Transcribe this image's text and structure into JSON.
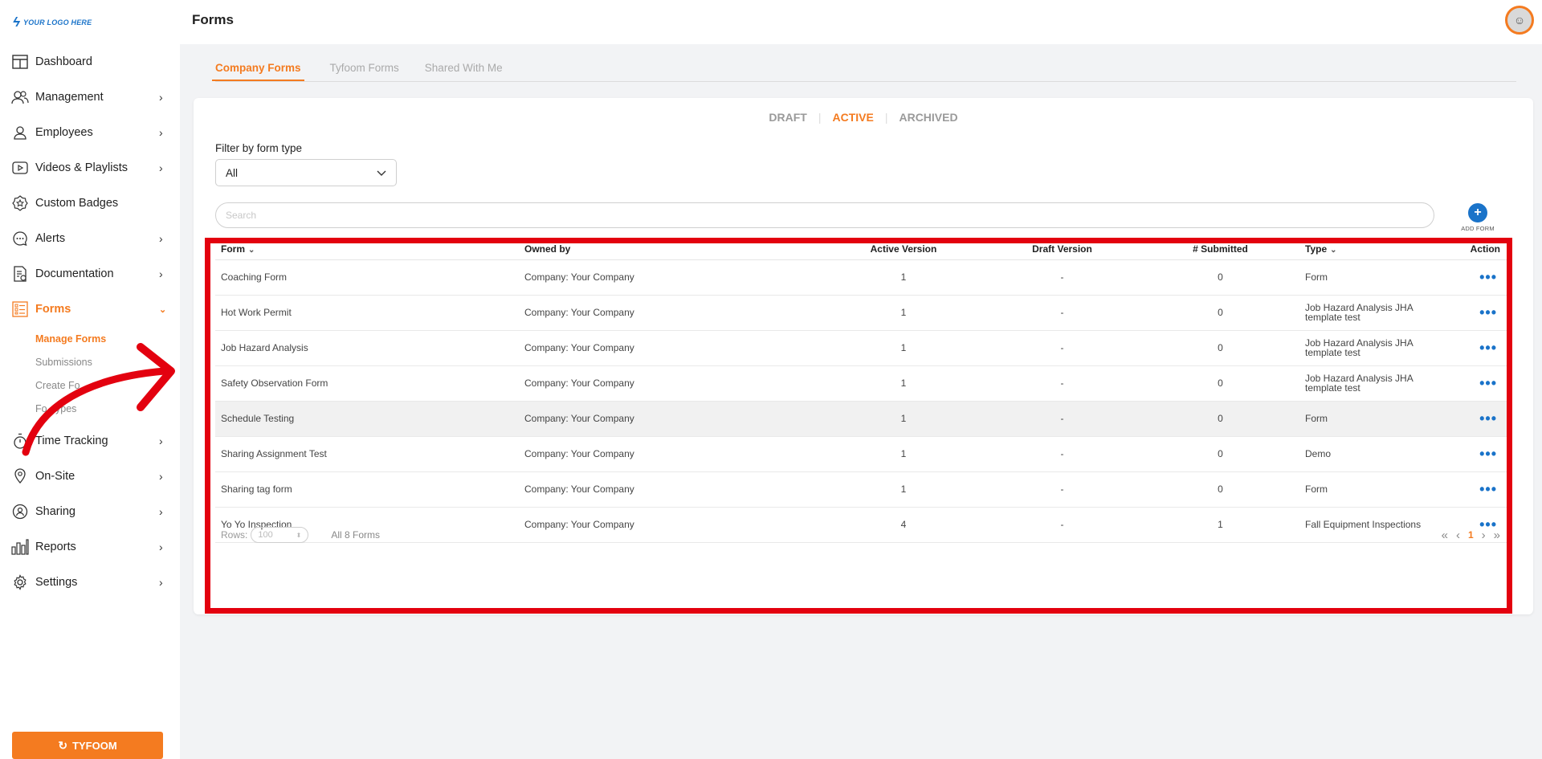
{
  "logo": {
    "text": "YOUR LOGO HERE"
  },
  "sidebar": {
    "items": [
      {
        "label": "Dashboard",
        "icon": "dashboard-icon",
        "chevron": false
      },
      {
        "label": "Management",
        "icon": "users-icon",
        "chevron": true
      },
      {
        "label": "Employees",
        "icon": "user-icon",
        "chevron": true
      },
      {
        "label": "Videos & Playlists",
        "icon": "play-icon",
        "chevron": true
      },
      {
        "label": "Custom Badges",
        "icon": "badge-icon",
        "chevron": false
      },
      {
        "label": "Alerts",
        "icon": "chat-icon",
        "chevron": true
      },
      {
        "label": "Documentation",
        "icon": "document-icon",
        "chevron": true
      },
      {
        "label": "Forms",
        "icon": "form-list-icon",
        "chevron": true,
        "active": true
      }
    ],
    "forms_sub": [
      "Manage Forms",
      "Submissions",
      "Create Fo",
      "Fo   ypes"
    ],
    "items_after": [
      {
        "label": "Time Tracking",
        "icon": "stopwatch-icon"
      },
      {
        "label": "On-Site",
        "icon": "location-pin-icon"
      },
      {
        "label": "Sharing",
        "icon": "share-user-icon"
      },
      {
        "label": "Reports",
        "icon": "bar-chart-icon"
      },
      {
        "label": "Settings",
        "icon": "gear-icon"
      }
    ],
    "brand_button": "TYFOOM"
  },
  "header": {
    "title": "Forms"
  },
  "tabs": [
    "Company Forms",
    "Tyfoom Forms",
    "Shared With Me"
  ],
  "status_tabs": [
    "DRAFT",
    "ACTIVE",
    "ARCHIVED"
  ],
  "filter": {
    "label": "Filter by form type",
    "value": "All"
  },
  "search": {
    "placeholder": "Search"
  },
  "add_form": {
    "label": "ADD FORM"
  },
  "table": {
    "columns": [
      "Form",
      "Owned by",
      "Active Version",
      "Draft Version",
      "# Submitted",
      "Type",
      "Action"
    ],
    "rows": [
      {
        "form": "Coaching Form",
        "owner": "Company: Your Company",
        "active": "1",
        "draft": "-",
        "submitted": "0",
        "type": "Form"
      },
      {
        "form": "Hot Work Permit",
        "owner": "Company: Your Company",
        "active": "1",
        "draft": "-",
        "submitted": "0",
        "type": "Job Hazard Analysis JHA template test"
      },
      {
        "form": "Job Hazard Analysis",
        "owner": "Company: Your Company",
        "active": "1",
        "draft": "-",
        "submitted": "0",
        "type": "Job Hazard Analysis JHA template test"
      },
      {
        "form": "Safety Observation Form",
        "owner": "Company: Your Company",
        "active": "1",
        "draft": "-",
        "submitted": "0",
        "type": "Job Hazard Analysis JHA template test"
      },
      {
        "form": "Schedule Testing",
        "owner": "Company: Your Company",
        "active": "1",
        "draft": "-",
        "submitted": "0",
        "type": "Form"
      },
      {
        "form": "Sharing Assignment Test",
        "owner": "Company: Your Company",
        "active": "1",
        "draft": "-",
        "submitted": "0",
        "type": "Demo"
      },
      {
        "form": "Sharing tag form",
        "owner": "Company: Your Company",
        "active": "1",
        "draft": "-",
        "submitted": "0",
        "type": "Form"
      },
      {
        "form": "Yo Yo Inspection",
        "owner": "Company: Your Company",
        "active": "4",
        "draft": "-",
        "submitted": "1",
        "type": "Fall Equipment Inspections"
      }
    ]
  },
  "footer": {
    "rows_label": "Rows:",
    "rows_value": "100",
    "count": "All 8 Forms",
    "page": "1"
  },
  "colors": {
    "accent": "#f47b20",
    "link": "#1a73c9",
    "annotation": "#e3010f"
  }
}
